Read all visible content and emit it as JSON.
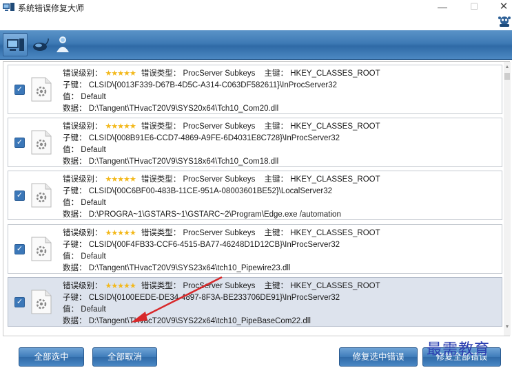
{
  "window": {
    "title": "系统错误修复大师",
    "minimize": "—",
    "maximize": "☐",
    "close": "✕"
  },
  "labels": {
    "level": "错误级别：",
    "type": "错误类型：",
    "root": "主键：",
    "subkey": "子键：",
    "value": "值：",
    "data": "数据："
  },
  "stars": "★★★★★",
  "check_mark": "✓",
  "scroll": {
    "up": "▲",
    "down": "▼"
  },
  "errors": [
    {
      "type": "ProcServer Subkeys",
      "root": "HKEY_CLASSES_ROOT",
      "subkey": "CLSID\\{0013F339-D67B-4D5C-A314-C063DF582611}\\InProcServer32",
      "value": "Default",
      "data": "D:\\Tangent\\THvacT20V9\\SYS20x64\\Tch10_Com20.dll",
      "checked": true,
      "selected": false
    },
    {
      "type": "ProcServer Subkeys",
      "root": "HKEY_CLASSES_ROOT",
      "subkey": "CLSID\\{008B91E6-CCD7-4869-A9FE-6D4031E8C728}\\InProcServer32",
      "value": "Default",
      "data": "D:\\Tangent\\THvacT20V9\\SYS18x64\\Tch10_Com18.dll",
      "checked": true,
      "selected": false
    },
    {
      "type": "ProcServer Subkeys",
      "root": "HKEY_CLASSES_ROOT",
      "subkey": "CLSID\\{00C6BF00-483B-11CE-951A-08003601BE52}\\LocalServer32",
      "value": "Default",
      "data": "D:\\PROGRA~1\\GSTARS~1\\GSTARC~2\\Program\\Edge.exe /automation",
      "checked": true,
      "selected": false
    },
    {
      "type": "ProcServer Subkeys",
      "root": "HKEY_CLASSES_ROOT",
      "subkey": "CLSID\\{00F4FB33-CCF6-4515-BA77-46248D1D12CB}\\InProcServer32",
      "value": "Default",
      "data": "D:\\Tangent\\THvacT20V9\\SYS23x64\\tch10_Pipewire23.dll",
      "checked": true,
      "selected": false
    },
    {
      "type": "ProcServer Subkeys",
      "root": "HKEY_CLASSES_ROOT",
      "subkey": "CLSID\\{0100EEDE-DE34-4897-8F3A-BE233706DE91}\\InProcServer32",
      "value": "Default",
      "data": "D:\\Tangent\\THvacT20V9\\SYS22x64\\tch10_PipeBaseCom22.dll",
      "checked": true,
      "selected": true
    }
  ],
  "buttons": {
    "select_all": "全部选中",
    "cancel_all": "全部取消",
    "repair_selected": "修复选中错误",
    "repair_all": "修复全部错误"
  },
  "watermark": "最需教育",
  "colors": {
    "toolbar": "#3e7ab5",
    "button": "#3f7cba",
    "stars": "#f3b81a",
    "selected_row": "#dde3ed",
    "arrow": "#d8282a"
  }
}
